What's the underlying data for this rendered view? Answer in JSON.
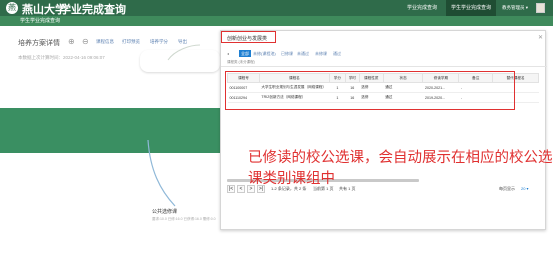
{
  "header": {
    "logo_glyph": "燕",
    "brand": "燕山大学",
    "title": "学业完成查询",
    "nav": [
      "学业完成查询",
      "学生学业完成查询"
    ],
    "user": "教务管理员 ▾"
  },
  "subbar": {
    "tab": "学生学业完成查询"
  },
  "left_panel": {
    "title": "培养方案详情",
    "menu": [
      "课程信息",
      "打印预览",
      "培养学分",
      "导出"
    ],
    "updated": "本数据上次计算时间：2022-04-16 09:06:07",
    "node_title": "公共选修课",
    "node_sub": "要求:10.0 已修:16.0 已获得:16.0 需修:0.0"
  },
  "dialog": {
    "title": "创新创业与发展类",
    "close": "✕",
    "filters": [
      "全部",
      "未修(课程池)",
      "已修课",
      "未通过",
      "未修课",
      "通过"
    ],
    "subnote": "课程类 (未分课程)",
    "table": {
      "headers": [
        "课程号",
        "课程名",
        "学分",
        "学时",
        "课程性质",
        "状态",
        "修读学期",
        "备注",
        "替代课程名"
      ],
      "rows": [
        [
          "001100007",
          "大学生职业规划与生涯发展（网络课程）",
          "1",
          "16",
          "选修",
          "通过",
          "2020-2021...",
          "-",
          ""
        ],
        [
          "001110294",
          "TRIZ创新方法（网络课程）",
          "1",
          "16",
          "选修",
          "通过",
          "2019-2020...",
          "-",
          ""
        ]
      ]
    },
    "pager": {
      "first": "|<",
      "prev": "<",
      "next": ">",
      "last": ">|",
      "range": "1-2 条记录，共 2 条",
      "page_label": "当前第 1 页",
      "pages_label": "共有 1 页",
      "per_page": "每页显示",
      "per_page_value": "20 ▾"
    }
  },
  "caption": "已修读的校公选课，会自动展示在相应的校公选课类别课组中",
  "colors": {
    "header": "#2f6b4a",
    "accent_red": "#e03131",
    "link_blue": "#1e7fd2"
  }
}
